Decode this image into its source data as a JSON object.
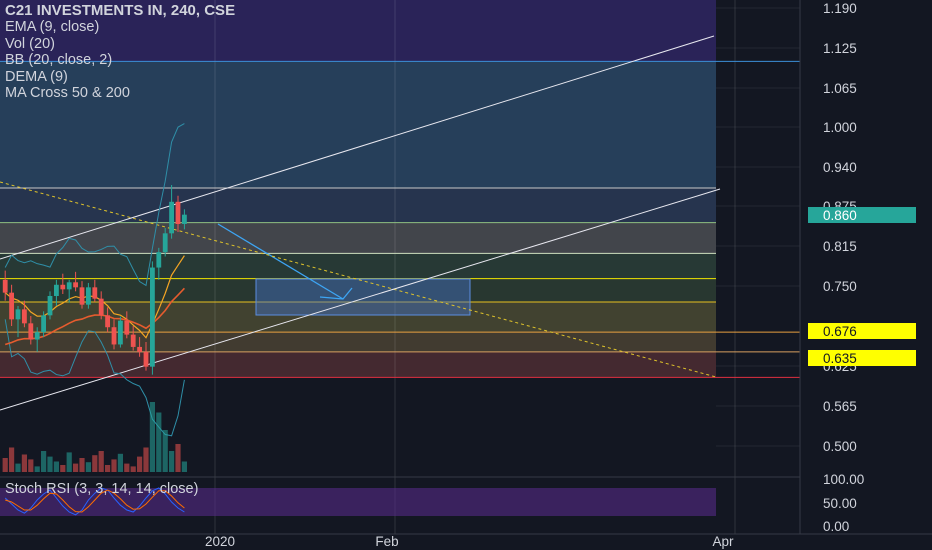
{
  "chart_data": {
    "type": "candlestick",
    "title": "C21 INVESTMENTS IN, 240, CSE",
    "indicators": [
      "EMA (9, close)",
      "Vol (20)",
      "BB (20, close, 2)",
      "DEMA (9)",
      "MA Cross 50 & 200"
    ],
    "price_axis": {
      "ticks": [
        "1.190",
        "1.125",
        "1.065",
        "1.000",
        "0.940",
        "0.875",
        "0.815",
        "0.750",
        "0.625",
        "0.565",
        "0.500"
      ],
      "range": [
        0.47,
        1.21
      ]
    },
    "time_axis": {
      "ticks": [
        "2020",
        "Feb",
        "Apr"
      ]
    },
    "last_price": "0.860",
    "price_labels": [
      {
        "text": "0.860",
        "value": 0.86,
        "color": "#26a69a",
        "text_color": "#ffffff"
      },
      {
        "text": "0.676",
        "value": 0.676,
        "color": "#ffff00",
        "text_color": "#131722"
      },
      {
        "text": "0.635",
        "value": 0.635,
        "color": "#ffff00",
        "text_color": "#131722"
      }
    ],
    "fib_levels": [
      1.105,
      0.905,
      0.85,
      0.803,
      0.762,
      0.726,
      0.68,
      0.648,
      0.608
    ],
    "fib_fills": [
      "#2a4664",
      "#2a3a56",
      "#4b4d52",
      "#2b3f38",
      "#2d3d33",
      "#4a4a33",
      "#4a4232",
      "#4d2d33",
      "#4d272e"
    ],
    "candles": [
      [
        0.76,
        0.775,
        0.728,
        0.74
      ],
      [
        0.74,
        0.752,
        0.69,
        0.7
      ],
      [
        0.7,
        0.72,
        0.672,
        0.715
      ],
      [
        0.715,
        0.728,
        0.688,
        0.694
      ],
      [
        0.694,
        0.705,
        0.66,
        0.668
      ],
      [
        0.668,
        0.688,
        0.648,
        0.68
      ],
      [
        0.68,
        0.712,
        0.672,
        0.706
      ],
      [
        0.706,
        0.742,
        0.7,
        0.735
      ],
      [
        0.735,
        0.76,
        0.72,
        0.752
      ],
      [
        0.752,
        0.77,
        0.738,
        0.745
      ],
      [
        0.745,
        0.76,
        0.725,
        0.756
      ],
      [
        0.756,
        0.773,
        0.742,
        0.748
      ],
      [
        0.748,
        0.758,
        0.716,
        0.722
      ],
      [
        0.722,
        0.755,
        0.716,
        0.748
      ],
      [
        0.748,
        0.76,
        0.726,
        0.731
      ],
      [
        0.731,
        0.742,
        0.7,
        0.706
      ],
      [
        0.706,
        0.718,
        0.68,
        0.688
      ],
      [
        0.688,
        0.7,
        0.652,
        0.66
      ],
      [
        0.66,
        0.704,
        0.655,
        0.698
      ],
      [
        0.698,
        0.712,
        0.67,
        0.676
      ],
      [
        0.676,
        0.69,
        0.65,
        0.656
      ],
      [
        0.656,
        0.672,
        0.64,
        0.648
      ],
      [
        0.648,
        0.664,
        0.618,
        0.624
      ],
      [
        0.624,
        0.79,
        0.612,
        0.78
      ],
      [
        0.78,
        0.812,
        0.76,
        0.805
      ],
      [
        0.805,
        0.842,
        0.798,
        0.834
      ],
      [
        0.834,
        0.91,
        0.826,
        0.882
      ],
      [
        0.882,
        0.892,
        0.836,
        0.848
      ],
      [
        0.848,
        0.87,
        0.84,
        0.862
      ]
    ],
    "volume": [
      0.2,
      0.35,
      0.12,
      0.25,
      0.18,
      0.08,
      0.3,
      0.22,
      0.15,
      0.1,
      0.28,
      0.12,
      0.2,
      0.14,
      0.24,
      0.3,
      0.1,
      0.18,
      0.26,
      0.12,
      0.08,
      0.22,
      0.35,
      1.0,
      0.85,
      0.6,
      0.3,
      0.4,
      0.15
    ],
    "stoch_rsi": {
      "label": "Stoch RSI (3, 3, 14, 14, close)",
      "ticks": [
        "100.00",
        "50.00",
        "0.00"
      ],
      "k": [
        60,
        45,
        30,
        22,
        35,
        55,
        70,
        80,
        60,
        40,
        25,
        18,
        30,
        55,
        72,
        85,
        80,
        60,
        42,
        30,
        25,
        40,
        60,
        78,
        85,
        70,
        50,
        35,
        25
      ],
      "d": [
        55,
        50,
        40,
        30,
        30,
        42,
        58,
        72,
        70,
        55,
        38,
        26,
        25,
        38,
        55,
        72,
        80,
        72,
        58,
        42,
        32,
        33,
        45,
        62,
        78,
        78,
        65,
        48,
        35
      ]
    }
  }
}
